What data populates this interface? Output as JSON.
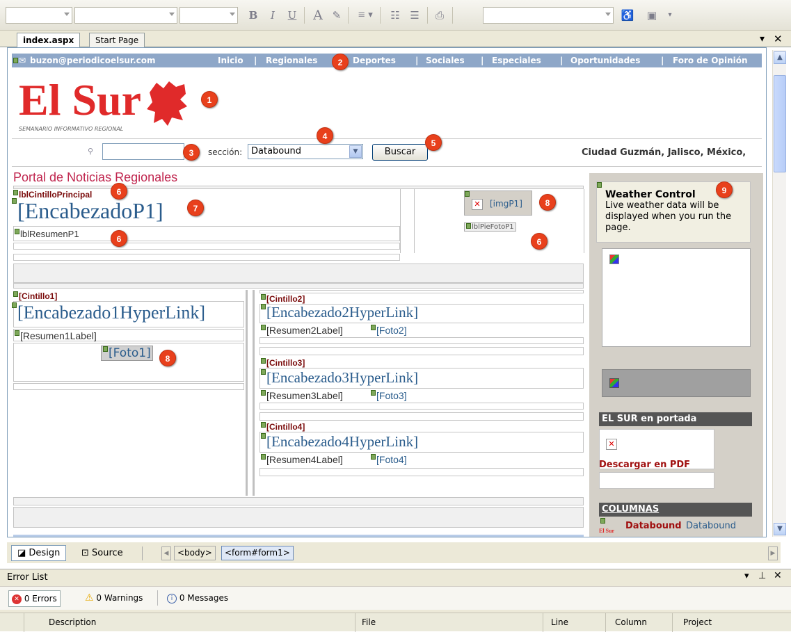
{
  "toolbar": {
    "bold": "B",
    "italic": "I",
    "underline": "U",
    "fore_color": "A"
  },
  "tabs": [
    {
      "label": "index.aspx"
    },
    {
      "label": "Start Page"
    }
  ],
  "panel_controls": {
    "dropdown": "▾",
    "close": "✕",
    "pin": "⊥"
  },
  "page": {
    "email": "buzon@periodicoelsur.com",
    "nav": [
      "Inicio",
      "Regionales",
      "Deportes",
      "Sociales",
      "Especiales",
      "Oportunidades",
      "Foro de Opinión"
    ],
    "logo_text": "El Sur",
    "logo_sub": "SEMANARIO INFORMATIVO REGIONAL",
    "section_label": "sección:",
    "section_value": "Databound",
    "search_button": "Buscar",
    "location": "Ciudad Guzmán, Jalisco, México,",
    "portal_title": "Portal de Noticias Regionales",
    "lbl_cintillo_principal": "lblCintilloPrincipal",
    "encabezado_p1": "[EncabezadoP1]",
    "lbl_resumen_p1": "lblResumenP1",
    "img_p1": "[imgP1]",
    "lbl_pie_foto_p1": "lblPieFotoP1",
    "cintillo1": "[Cintillo1]",
    "encabezado1": "[Encabezado1HyperLink]",
    "resumen1": "[Resumen1Label]",
    "foto1": "[Foto1]",
    "cintillo2": "[Cintillo2]",
    "encabezado2": "[Encabezado2HyperLink]",
    "resumen2": "[Resumen2Label]",
    "foto2": "[Foto2]",
    "cintillo3": "[Cintillo3]",
    "encabezado3": "[Encabezado3HyperLink]",
    "resumen3": "[Resumen3Label]",
    "foto3": "[Foto3]",
    "cintillo4": "[Cintillo4]",
    "encabezado4": "[Encabezado4HyperLink]",
    "resumen4": "[Resumen4Label]",
    "foto4": "[Foto4]",
    "weather_title": "Weather Control",
    "weather_text": "Live weather data will be displayed when you run the page.",
    "portada_header": "EL SUR en portada",
    "descargar": "Descargar en PDF",
    "columnas_header": "COLUMNAS",
    "databound_bold": "Databound",
    "databound_link": "Databound",
    "mini_logo": "El Sur"
  },
  "callouts": [
    "1",
    "2",
    "3",
    "4",
    "5",
    "6",
    "7",
    "8",
    "6",
    "6",
    "8",
    "9"
  ],
  "view_bar": {
    "design": "Design",
    "source": "Source",
    "crumb_body": "<body>",
    "crumb_form": "<form#form1>"
  },
  "error_list": {
    "title": "Error List",
    "errors": "0 Errors",
    "warnings": "0 Warnings",
    "messages": "0 Messages",
    "columns": [
      "Description",
      "File",
      "Line",
      "Column",
      "Project"
    ]
  },
  "colors": {
    "accent_red": "#e02a2a",
    "nav_blue": "#8ea7c8",
    "callout": "#e8401c",
    "link_blue": "#2a5c8c"
  }
}
